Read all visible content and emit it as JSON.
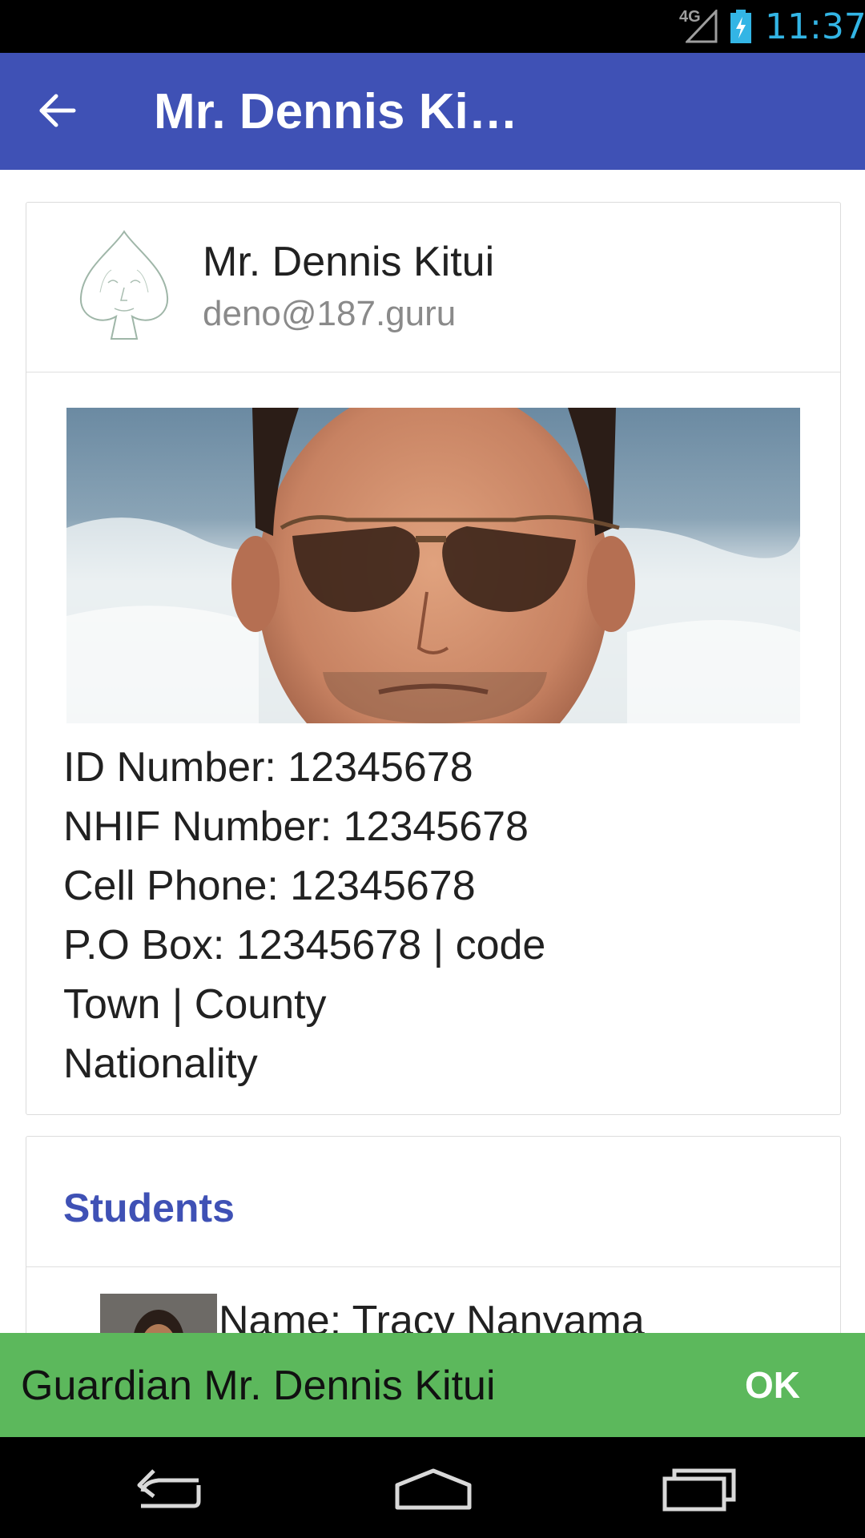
{
  "status_bar": {
    "network": "4G",
    "time": "11:37"
  },
  "app_bar": {
    "title": "Mr. Dennis Ki…"
  },
  "profile": {
    "name": "Mr. Dennis Kitui",
    "email": "deno@187.guru",
    "details": [
      "ID Number: 12345678",
      "NHIF Number: 12345678",
      "Cell Phone: 12345678",
      "P.O Box: 12345678 | code",
      "Town | County",
      "Nationality"
    ]
  },
  "students": {
    "title": "Students",
    "items": [
      {
        "name": "Name: Tracy Nanyama"
      }
    ]
  },
  "snackbar": {
    "message": "Guardian Mr. Dennis Kitui",
    "action": "OK"
  },
  "colors": {
    "primary": "#3f51b5",
    "snackbar": "#5cb85c",
    "clock": "#33b5e5"
  },
  "icons": [
    "signal-icon",
    "battery-icon",
    "back-arrow-icon",
    "spade-logo-icon",
    "nav-back-icon",
    "nav-home-icon",
    "nav-recent-icon"
  ]
}
